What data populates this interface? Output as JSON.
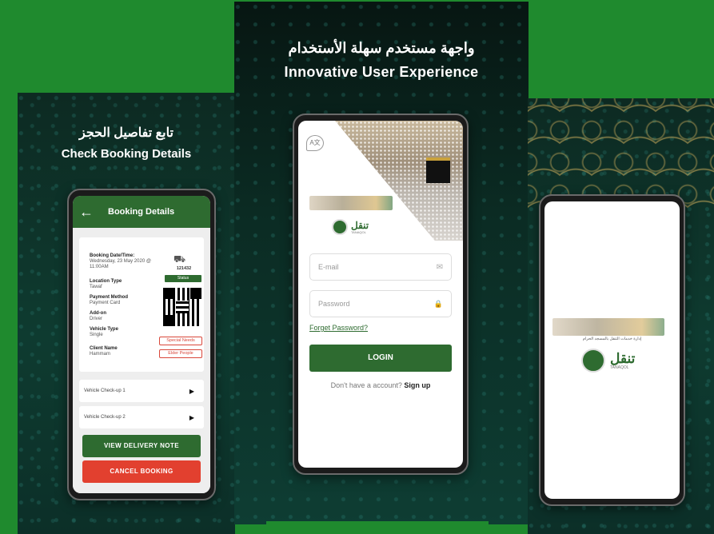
{
  "left_panel": {
    "heading_ar": "تابع تفاصيل الحجز",
    "heading_en": "Check Booking Details",
    "screen": {
      "title": "Booking Details",
      "fields": [
        {
          "label": "Booking Date/Time:",
          "value": "Wednesday, 23 May 2020 @ 11:00AM"
        },
        {
          "label": "Location Type",
          "value": "Tawaf"
        },
        {
          "label": "Payment Method",
          "value": "Payment Card"
        },
        {
          "label": "Add-on",
          "value": "Driver"
        },
        {
          "label": "Vehicle Type",
          "value": "Single"
        },
        {
          "label": "Client Name",
          "value": "Hammam"
        }
      ],
      "booking_number": "121432",
      "status_label": "Status",
      "tags": [
        "Special Needs",
        "Elder People"
      ],
      "checkups": [
        "Vehicle Check-up 1",
        "Vehicle Check-up 2"
      ],
      "view_delivery_note": "VIEW DELIVERY NOTE",
      "cancel_booking": "CANCEL BOOKING"
    }
  },
  "middle_panel": {
    "heading_ar": "واجهة مستخدم سهلة الأستخدام",
    "heading_en": "Innovative User Experience",
    "screen": {
      "email_placeholder": "E-mail",
      "password_placeholder": "Password",
      "forgot_password": "Forget Password?",
      "login_label": "LOGIN",
      "no_account": "Don't have a account?",
      "signup_label": "Sign up",
      "brand_ar": "تنقل",
      "brand_en": "TANAQOL"
    }
  },
  "right_panel": {
    "brand_ar": "تنقل",
    "brand_en": "TANAQOL",
    "authority_ar": "إدارة خدمات التنقل بالمسجد الحرام"
  },
  "colors": {
    "brand_green": "#2e6b30",
    "cancel_red": "#e2402f",
    "background_green": "#1f8a2e"
  }
}
